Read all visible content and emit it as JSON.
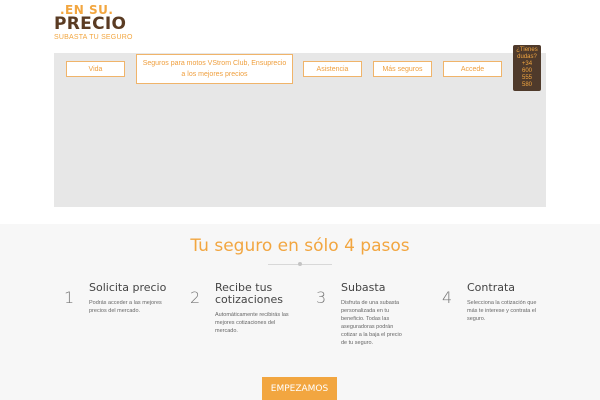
{
  "brand": {
    "top": ".EN SU.",
    "main": "PRECIO",
    "tagline": "SUBASTA TU SEGURO"
  },
  "nav": {
    "vida": "Vida",
    "featured": "Seguros para motos VStrom Club, Ensuprecio a los mejores precios",
    "asistencia": "Asistencia",
    "mas_seguros": "Más seguros",
    "accede": "Accede"
  },
  "help": {
    "line1": "¿Tienes",
    "line2": "dudas?",
    "line3": "+34",
    "line4": "600",
    "line5": "555",
    "line6": "580"
  },
  "section": {
    "title": "Tu seguro en sólo 4 pasos"
  },
  "steps": [
    {
      "number": "1",
      "title": "Solicita precio",
      "description": "Podrás acceder a las mejores precios del mercado."
    },
    {
      "number": "2",
      "title": "Recibe tus cotizaciones",
      "description": "Automáticamente recibirás las mejores cotizaciones del mercado."
    },
    {
      "number": "3",
      "title": "Subasta",
      "description": "Disfruta de una subasta personalizada en tu beneficio. Todas las aseguradoras podrán cotizar a la baja el precio de tu seguro."
    },
    {
      "number": "4",
      "title": "Contrata",
      "description": "Selecciona la cotización que más te interese y contrata el seguro."
    }
  ],
  "cta": {
    "label": "EMPEZAMOS"
  },
  "colors": {
    "accent": "#f2a640",
    "brand_dark": "#5a3b23",
    "panel": "#e7e7e7"
  }
}
